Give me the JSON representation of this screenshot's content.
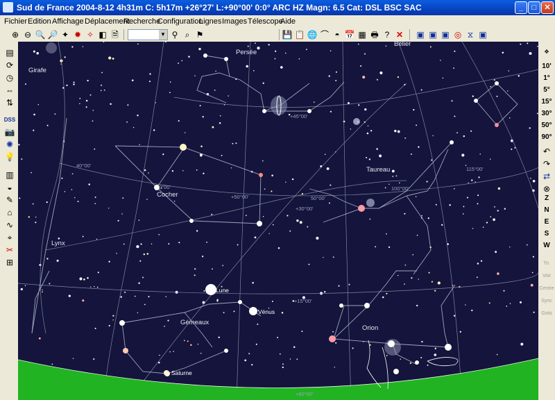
{
  "window": {
    "title": "Sud de France 2004-8-12   4h31m C:  5h17m +26°27' L:+90°00' 0:0°  ARC HZ  Magn: 6.5 Cat: DSL BSC SAC"
  },
  "menu": [
    "Fichier",
    "Edition",
    "Affichage",
    "Déplacement",
    "Recherche",
    "Configuration",
    "Lignes",
    "Images",
    "Télescope",
    "Aide"
  ],
  "zoom_buttons": [
    "10'",
    "1°",
    "5°",
    "15°",
    "30°",
    "50°",
    "90°"
  ],
  "direction_buttons": [
    "Z",
    "N",
    "E",
    "S",
    "W"
  ],
  "disabled_buttons": [
    "Tri.",
    "Voir",
    "Centre",
    "Sync",
    "Goto"
  ],
  "constellations": [
    {
      "name": "Girafe"
    },
    {
      "name": "Persée"
    },
    {
      "name": "Bélier"
    },
    {
      "name": "Taureau"
    },
    {
      "name": "Cocher"
    },
    {
      "name": "Lynx"
    },
    {
      "name": "Gémeaux"
    },
    {
      "name": "Orion"
    }
  ],
  "bodies": [
    {
      "name": "Lune"
    },
    {
      "name": "Vénus"
    },
    {
      "name": "Saturne"
    }
  ],
  "grid_labels": [
    "+45°00'",
    "40°00'",
    "+50°00'",
    "+30°00'",
    "50°00'",
    "100°00'",
    "115°00'",
    "+15°00'",
    "+80°00'",
    "0°00'"
  ],
  "colors": {
    "sky": "#14143c",
    "ground": "#22b322",
    "grid": "#9aa3b8",
    "title_bar": "#0842c0"
  }
}
